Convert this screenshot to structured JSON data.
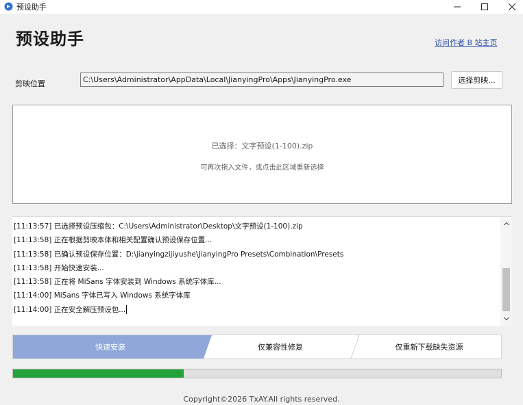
{
  "window": {
    "title": "预设助手",
    "icon": "app-icon",
    "controls": [
      "minimize-icon",
      "maximize-icon",
      "close-icon"
    ]
  },
  "header": {
    "title": "预设助手",
    "author_link": "访问作者 B 站主页"
  },
  "path": {
    "label": "剪映位置",
    "value": "C:\\Users\\Administrator\\AppData\\Local\\JianyingPro\\Apps\\JianyingPro.exe",
    "select_button": "选择剪映..."
  },
  "drop_zone": {
    "selected_text": "已选择：文字预设(1-100).zip",
    "hint_text": "可再次拖入文件，或点击此区域重新选择"
  },
  "log": [
    "[11:13:57] 已选择预设压缩包：C:\\Users\\Administrator\\Desktop\\文字预设(1-100).zip",
    "[11:13:58] 正在根据剪映本体和相关配置确认预设保存位置...",
    "[11:13:58] 已确认预设保存位置：D:\\jianyingzijiyushe\\JianyingPro Presets\\Combination\\Presets",
    "[11:13:58] 开始快速安装...",
    "[11:13:58] 正在将 MiSans 字体安装到 Windows 系统字体库...",
    "[11:14:00] MiSans 字体已写入 Windows 系统字体库",
    "[11:14:00] 正在安全解压预设包..."
  ],
  "modes": [
    {
      "label": "快速安装",
      "active": true
    },
    {
      "label": "仅兼容性修复",
      "active": false
    },
    {
      "label": "仅重新下载缺失资源",
      "active": false
    }
  ],
  "progress": {
    "fraction": 0.35
  },
  "footer": "Copyright©2026 TxAY.All rights reserved.",
  "colors": {
    "accent_mode": "#8fa8d9",
    "progress": "#23a33a",
    "link": "#2b4fa8"
  }
}
